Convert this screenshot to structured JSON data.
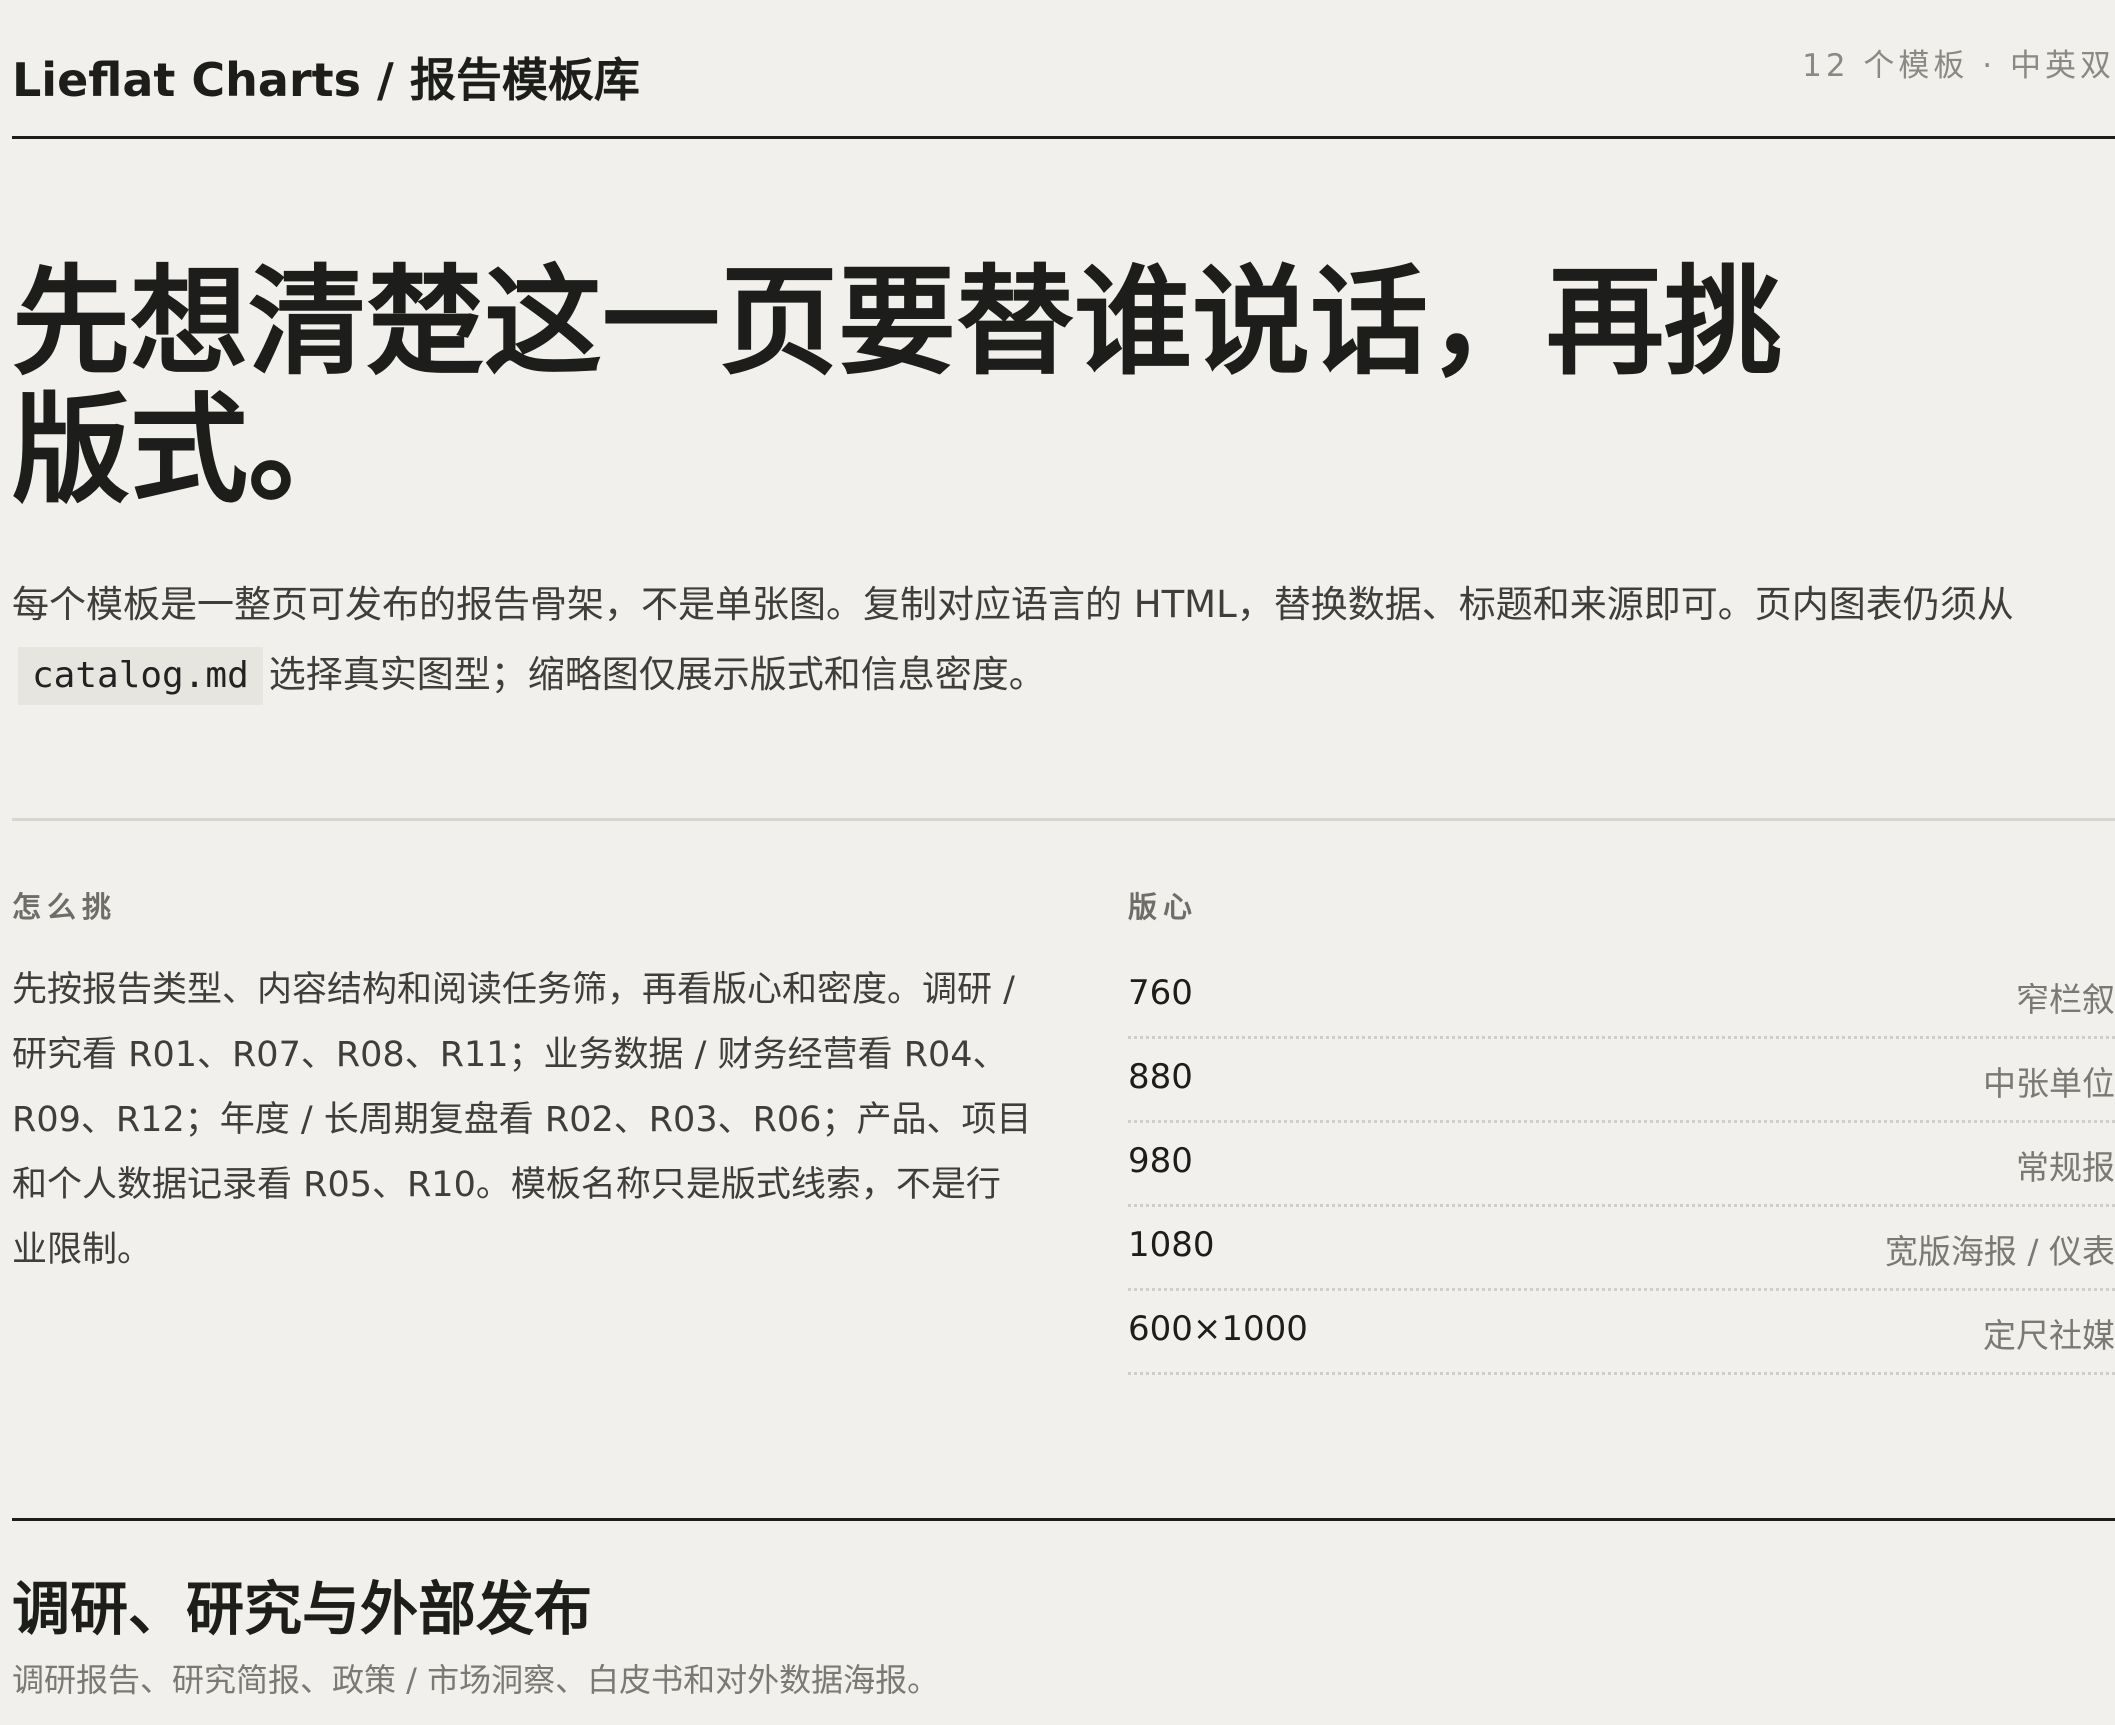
{
  "header": {
    "brand": "Lieflat Charts / 报告模板库",
    "meta": "12 个模板 · 中英双"
  },
  "hero": {
    "title": "先想清楚这一页要替谁说话，再挑版式。",
    "desc_before": "每个模板是一整页可发布的报告骨架，不是单张图。复制对应语言的 HTML，替换数据、标题和来源即可。页内图表仍须从",
    "code": "catalog.md",
    "desc_after": "选择真实图型；缩略图仅展示版式和信息密度。"
  },
  "how": {
    "label": "怎么挑",
    "text": "先按报告类型、内容结构和阅读任务筛，再看版心和密度。调研 / 研究看 R01、R07、R08、R11；业务数据 / 财务经营看 R04、R09、R12；年度 / 长周期复盘看 R02、R03、R06；产品、项目和个人数据记录看 R05、R10。模板名称只是版式线索，不是行业限制。"
  },
  "layout": {
    "label": "版心",
    "rows": [
      {
        "size": "760",
        "use": "窄栏叙"
      },
      {
        "size": "880",
        "use": "中张单位"
      },
      {
        "size": "980",
        "use": "常规报"
      },
      {
        "size": "1080",
        "use": "宽版海报 / 仪表"
      },
      {
        "size": "600×1000",
        "use": "定尺社媒"
      }
    ]
  },
  "section": {
    "title": "调研、研究与外部发布",
    "desc": "调研报告、研究简报、政策 / 市场洞察、白皮书和对外数据海报。"
  }
}
